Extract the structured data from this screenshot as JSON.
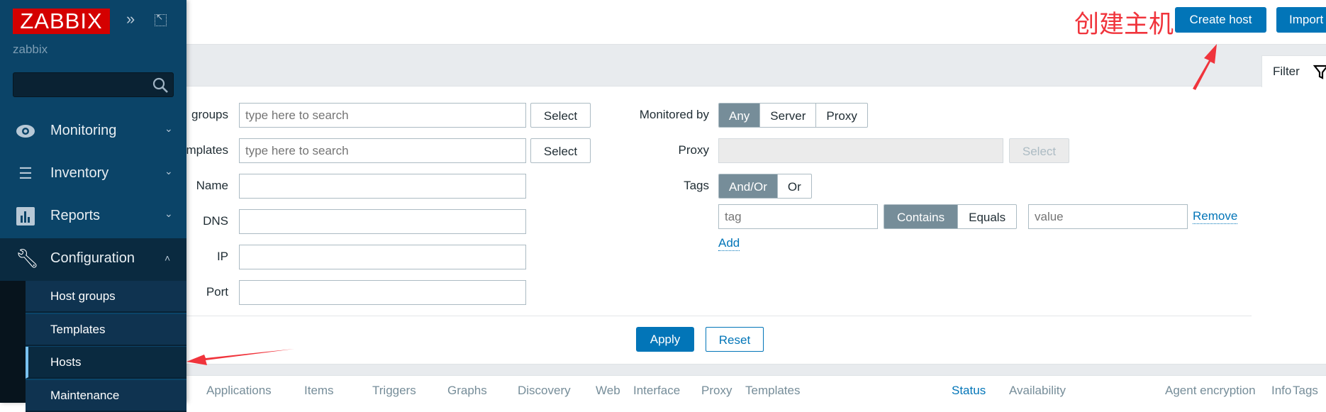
{
  "sidebar": {
    "logo": "ZABBIX",
    "server_name": "zabbix",
    "collapse_icon": "chevrons-right-icon",
    "kiosk_icon": "expand-icon",
    "search_icon": "search-icon",
    "menu": [
      {
        "label": "Monitoring",
        "icon": "eye-icon"
      },
      {
        "label": "Inventory",
        "icon": "list-icon"
      },
      {
        "label": "Reports",
        "icon": "bar-chart-icon"
      },
      {
        "label": "Configuration",
        "icon": "wrench-icon"
      }
    ],
    "submenu": [
      {
        "label": "Host groups"
      },
      {
        "label": "Templates"
      },
      {
        "label": "Hosts",
        "active": true
      },
      {
        "label": "Maintenance"
      }
    ]
  },
  "header": {
    "create_host": "Create host",
    "import": "Import",
    "annotation": "创建主机"
  },
  "filter": {
    "tab_label": "Filter",
    "host_groups": {
      "label": "groups",
      "placeholder": "type here to search",
      "button": "Select"
    },
    "templates": {
      "label": "mplates",
      "placeholder": "type here to search",
      "button": "Select"
    },
    "name": {
      "label": "Name",
      "value": ""
    },
    "dns": {
      "label": "DNS",
      "value": ""
    },
    "ip": {
      "label": "IP",
      "value": ""
    },
    "port": {
      "label": "Port",
      "value": ""
    },
    "monitored_by": {
      "label": "Monitored by",
      "options": [
        "Any",
        "Server",
        "Proxy"
      ],
      "selected": "Any"
    },
    "proxy": {
      "label": "Proxy",
      "button": "Select"
    },
    "tags": {
      "label": "Tags",
      "options": [
        "And/Or",
        "Or"
      ],
      "selected": "And/Or",
      "tag_placeholder": "tag",
      "operators": [
        "Contains",
        "Equals"
      ],
      "operator_selected": "Contains",
      "value_placeholder": "value",
      "remove": "Remove",
      "add": "Add"
    },
    "apply": "Apply",
    "reset": "Reset"
  },
  "table": {
    "columns": [
      "Applications",
      "Items",
      "Triggers",
      "Graphs",
      "Discovery",
      "Web",
      "Interface",
      "Proxy",
      "Templates",
      "Status",
      "Availability",
      "Agent encryption",
      "Info",
      "Tags"
    ],
    "sorted_column": "Status"
  },
  "colors": {
    "sidebar": "#0b4468",
    "accent": "#0275b8",
    "annotation": "#f0343c",
    "logo": "#d40000"
  }
}
